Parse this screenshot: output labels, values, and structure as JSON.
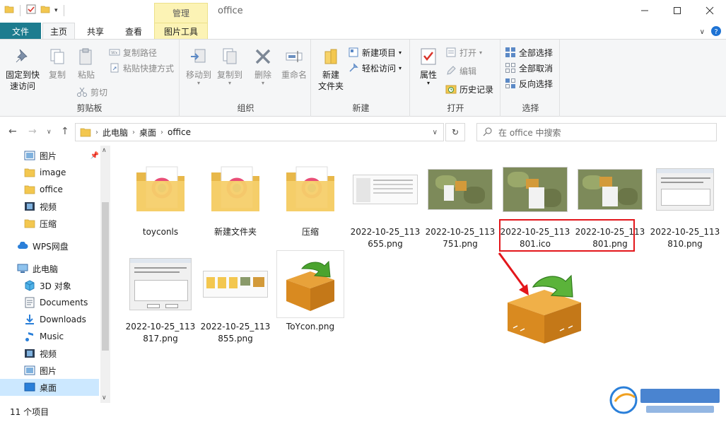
{
  "window": {
    "title": "office",
    "context_tab_header": "管理"
  },
  "tabs": {
    "file": "文件",
    "home": "主页",
    "share": "共享",
    "view": "查看",
    "picture_tools": "图片工具"
  },
  "ribbon": {
    "clipboard": {
      "label": "剪贴板",
      "pin": "固定到快速访问",
      "pin_line1": "固定到快",
      "pin_line2": "速访问",
      "copy": "复制",
      "paste": "粘贴",
      "copy_path": "复制路径",
      "paste_shortcut": "粘贴快捷方式",
      "cut": "剪切"
    },
    "organize": {
      "label": "组织",
      "move_to": "移动到",
      "copy_to": "复制到",
      "delete": "删除",
      "rename": "重命名"
    },
    "new": {
      "label": "新建",
      "new_folder_line1": "新建",
      "new_folder_line2": "文件夹",
      "new_item": "新建项目",
      "easy_access": "轻松访问"
    },
    "open": {
      "label": "打开",
      "properties": "属性",
      "open": "打开",
      "edit": "编辑",
      "history": "历史记录"
    },
    "select": {
      "label": "选择",
      "select_all": "全部选择",
      "select_none": "全部取消",
      "invert": "反向选择"
    }
  },
  "address": {
    "crumbs": [
      "此电脑",
      "桌面",
      "office"
    ],
    "search_placeholder": "在 office 中搜索"
  },
  "sidebar": {
    "items": [
      {
        "label": "图片",
        "icon": "pictures-icon"
      },
      {
        "label": "image",
        "icon": "folder-icon"
      },
      {
        "label": "office",
        "icon": "folder-icon"
      },
      {
        "label": "视频",
        "icon": "video-icon"
      },
      {
        "label": "压缩",
        "icon": "folder-icon"
      },
      {
        "label": "WPS网盘",
        "icon": "cloud-icon"
      },
      {
        "label": "此电脑",
        "icon": "computer-icon"
      },
      {
        "label": "3D 对象",
        "icon": "cube-icon"
      },
      {
        "label": "Documents",
        "icon": "documents-icon"
      },
      {
        "label": "Downloads",
        "icon": "downloads-icon"
      },
      {
        "label": "Music",
        "icon": "music-icon"
      },
      {
        "label": "视频",
        "icon": "video-icon"
      },
      {
        "label": "图片",
        "icon": "pictures-icon"
      },
      {
        "label": "桌面",
        "icon": "desktop-icon"
      }
    ]
  },
  "files": [
    {
      "name": "toyconls",
      "kind": "folder"
    },
    {
      "name": "新建文件夹",
      "kind": "folder"
    },
    {
      "name": "压缩",
      "kind": "folder"
    },
    {
      "name": "2022-10-25_113655.png",
      "kind": "screenshot"
    },
    {
      "name": "2022-10-25_113751.png",
      "kind": "map"
    },
    {
      "name": "2022-10-25_113801.ico",
      "kind": "map"
    },
    {
      "name": "2022-10-25_113801.png",
      "kind": "map"
    },
    {
      "name": "2022-10-25_113810.png",
      "kind": "dialog"
    },
    {
      "name": "2022-10-25_113817.png",
      "kind": "dialog"
    },
    {
      "name": "2022-10-25_113855.png",
      "kind": "strip"
    },
    {
      "name": "ToYcon.png",
      "kind": "box"
    }
  ],
  "status": {
    "count": "11 个项目"
  },
  "colors": {
    "file_tab": "#1d7c8f",
    "context_tab": "#fcf3b5",
    "selection": "#cce8ff",
    "highlight": "#e3161b"
  }
}
